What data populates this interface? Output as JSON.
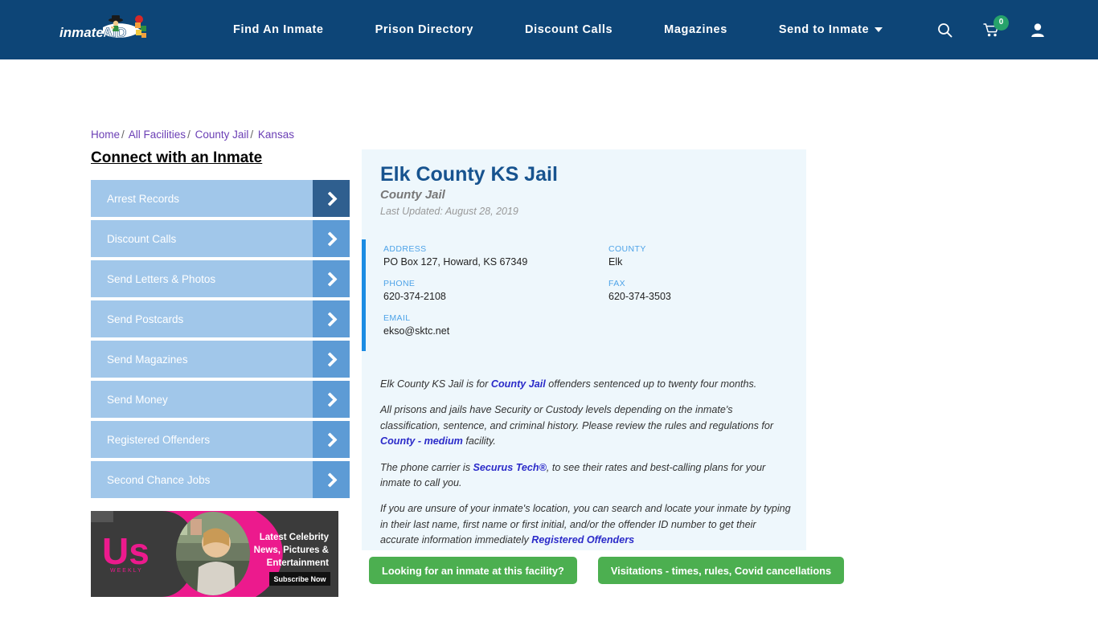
{
  "header": {
    "logo_text": "inmateAID",
    "nav": [
      {
        "label": "Find An Inmate"
      },
      {
        "label": "Prison Directory"
      },
      {
        "label": "Discount Calls"
      },
      {
        "label": "Magazines"
      },
      {
        "label": "Send to Inmate"
      }
    ],
    "icons": {
      "search": "search-icon",
      "cart": "cart-icon",
      "cart_count": "0",
      "account": "user-icon"
    },
    "colors": {
      "bar": "#0d4577",
      "badge": "#27a36b"
    }
  },
  "breadcrumb": [
    {
      "label": "Home"
    },
    {
      "label": "All Facilities"
    },
    {
      "label": "County Jail"
    },
    {
      "label": "Kansas"
    }
  ],
  "breadcrumb_separator": "/",
  "sidebar": {
    "title": "Connect with an Inmate",
    "items": [
      {
        "label": "Arrest Records",
        "active": true
      },
      {
        "label": "Discount Calls",
        "active": false
      },
      {
        "label": "Send Letters & Photos",
        "active": false
      },
      {
        "label": "Send Postcards",
        "active": false
      },
      {
        "label": "Send Magazines",
        "active": false
      },
      {
        "label": "Send Money",
        "active": false
      },
      {
        "label": "Registered Offenders",
        "active": false
      },
      {
        "label": "Second Chance Jobs",
        "active": false
      }
    ]
  },
  "ad": {
    "brand": "Us",
    "brand_sub": "WEEKLY",
    "line1": "Latest Celebrity",
    "line2": "News, Pictures &",
    "line3": "Entertainment",
    "cta": "Subscribe Now"
  },
  "facility": {
    "name": "Elk County KS Jail",
    "type": "County Jail",
    "last_updated": "Last Updated: August 28, 2019",
    "fields": [
      {
        "label": "ADDRESS",
        "value": "PO Box 127, Howard, KS 67349"
      },
      {
        "label": "COUNTY",
        "value": "Elk"
      },
      {
        "label": "PHONE",
        "value": "620-374-2108"
      },
      {
        "label": "FAX",
        "value": "620-374-3503"
      },
      {
        "label": "EMAIL",
        "value": "ekso@sktc.net"
      }
    ],
    "paragraphs": {
      "p1_a": "Elk County KS Jail is for ",
      "p1_link": "County Jail",
      "p1_b": " offenders sentenced up to twenty four months.",
      "p2_a": "All prisons and jails have Security or Custody levels depending on the inmate's classification, sentence, and criminal history. Please review the rules and regulations for ",
      "p2_link": "County - medium",
      "p2_b": " facility.",
      "p3_a": "The phone carrier is ",
      "p3_link": "Securus Tech®",
      "p3_b": ", to see their rates and best-calling plans for your inmate to call you.",
      "p4_a": "If you are unsure of your inmate's location, you can search and locate your inmate by typing in their last name, first name or first initial, and/or the offender ID number to get their accurate information immediately ",
      "p4_link": "Registered Offenders"
    }
  },
  "actions": {
    "find_inmate": "Looking for an inmate at this facility?",
    "visitations": "Visitations - times, rules, Covid cancellations"
  },
  "colors": {
    "accent_blue": "#1b8ce3",
    "card_bg": "#eef7fc",
    "green": "#4caf50",
    "title_blue": "#17538f"
  }
}
